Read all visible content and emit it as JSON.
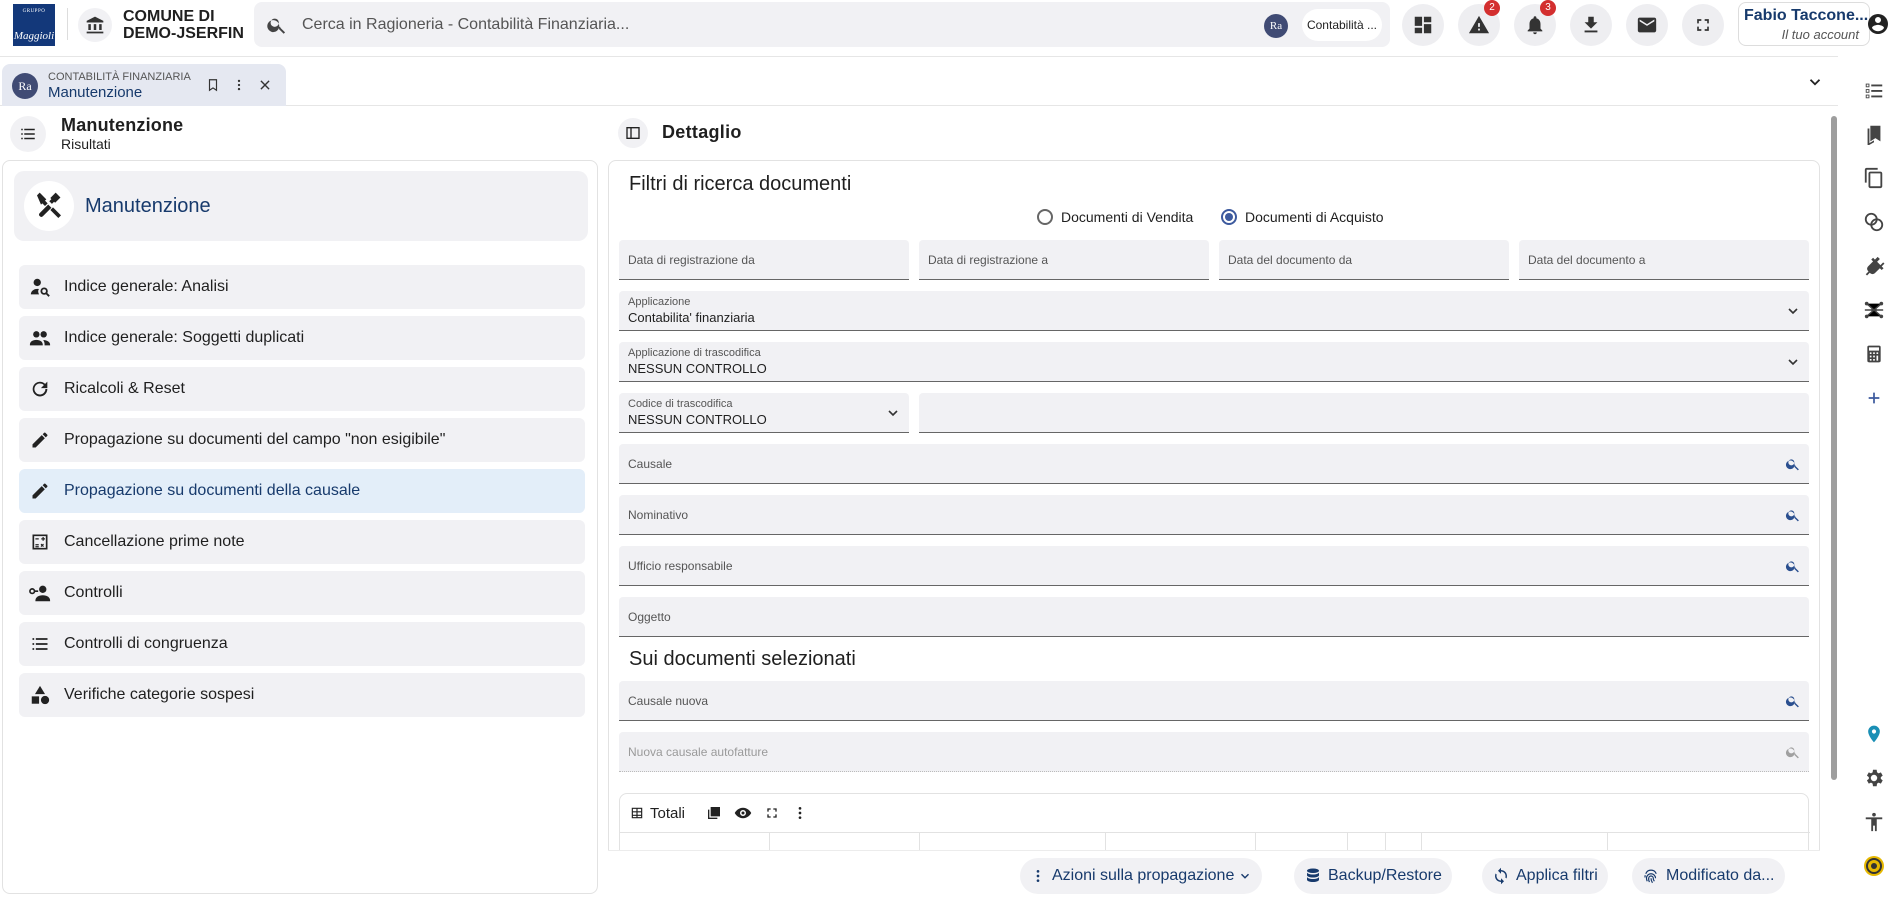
{
  "header": {
    "logo_top": "GRUPPO",
    "logo_bottom": "Maggioli",
    "org_line1": "COMUNE DI",
    "org_line2": "DEMO-JSERFIN",
    "search_placeholder": "Cerca in Ragioneria - Contabilità Finanziaria...",
    "search_scope_badge": "Ra",
    "search_scope": "Contabilità ...",
    "alerts_count": "2",
    "notifications_count": "3",
    "account_name": "Fabio Taccone...",
    "account_sub": "Il tuo account"
  },
  "tab": {
    "badge": "Ra",
    "module": "CONTABILITÀ FINANZIARIA",
    "title": "Manutenzione"
  },
  "left": {
    "title": "Manutenzione",
    "subtitle": "Risultati",
    "group_label": "Manutenzione",
    "items": [
      {
        "label": "Indice generale: Analisi",
        "icon": "person-search-icon"
      },
      {
        "label": "Indice generale: Soggetti duplicati",
        "icon": "people-icon"
      },
      {
        "label": "Ricalcoli & Reset",
        "icon": "refresh-icon"
      },
      {
        "label": "Propagazione su documenti del campo \"non esigibile\"",
        "icon": "pencil-icon"
      },
      {
        "label": "Propagazione su documenti della causale",
        "icon": "pencil-icon"
      },
      {
        "label": "Cancellazione prime note",
        "icon": "calculator-icon"
      },
      {
        "label": "Controlli",
        "icon": "person-key-icon"
      },
      {
        "label": "Controlli di congruenza",
        "icon": "list-icon"
      },
      {
        "label": "Verifiche categorie sospesi",
        "icon": "shapes-icon"
      }
    ],
    "active_index": 4
  },
  "detail": {
    "title": "Dettaglio",
    "filters_title": "Filtri di ricerca documenti",
    "radio_vendita": "Documenti di Vendita",
    "radio_acquisto": "Documenti di Acquisto",
    "radio_selected": "acquisto",
    "date_reg_da": "Data di registrazione da",
    "date_reg_a": "Data di registrazione a",
    "date_doc_da": "Data del documento da",
    "date_doc_a": "Data del documento a",
    "applicazione_label": "Applicazione",
    "applicazione_value": "Contabilita' finanziaria",
    "app_trascodifica_label": "Applicazione di trascodifica",
    "app_trascodifica_value": "NESSUN CONTROLLO",
    "codice_trascodifica_label": "Codice di trascodifica",
    "codice_trascodifica_value": "NESSUN CONTROLLO",
    "causale": "Causale",
    "nominativo": "Nominativo",
    "ufficio": "Ufficio responsabile",
    "oggetto": "Oggetto",
    "selected_title": "Sui documenti selezionati",
    "causale_nuova": "Causale nuova",
    "nuova_causale_autofatture": "Nuova causale autofatture",
    "totali": "Totali"
  },
  "actions": {
    "propagation": "Azioni sulla propagazione",
    "backup": "Backup/Restore",
    "apply": "Applica filtri",
    "modified": "Modificato da..."
  },
  "colors": {
    "primary": "#173a6c",
    "surface": "#f1f1f4",
    "active_item": "#e3eef9",
    "badge_red": "#d32f2f",
    "brand_logo": "#13387a"
  }
}
